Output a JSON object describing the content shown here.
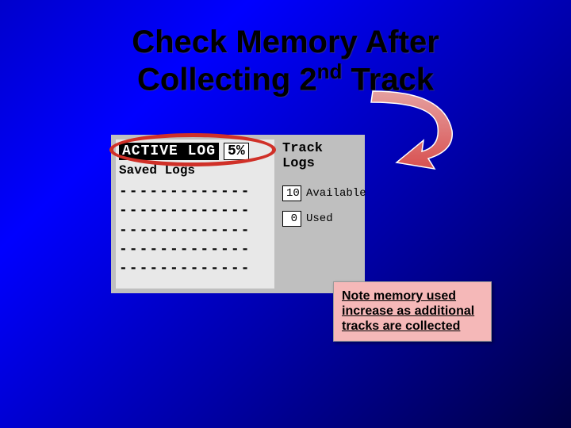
{
  "title": {
    "line1": "Check Memory After",
    "line2_pre": "Collecting 2",
    "line2_sup": "nd",
    "line2_post": " Track"
  },
  "gps": {
    "active_label": "ACTIVE LOG",
    "percent": "5%",
    "saved_label": "Saved Logs",
    "dash_rows": [
      "-------------",
      "-------------",
      "-------------",
      "-------------",
      "-------------"
    ],
    "right_title": "Track Logs",
    "available": {
      "value": "10",
      "label": "Available"
    },
    "used": {
      "value": "0",
      "label": "Used"
    }
  },
  "note": "Note memory used increase as additional tracks are collected",
  "colors": {
    "circle": "#d03028",
    "arrow_start": "#e5a0a0",
    "arrow_end": "#d85050",
    "note_bg": "#f5b8b8"
  }
}
